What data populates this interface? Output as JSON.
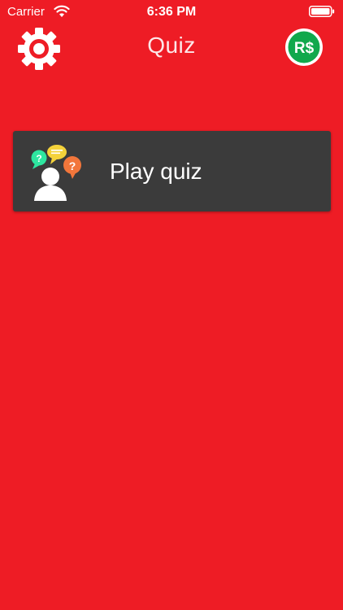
{
  "status_bar": {
    "carrier": "Carrier",
    "time": "6:36 PM",
    "wifi_icon": "wifi-icon",
    "battery_icon": "battery-icon"
  },
  "nav": {
    "title": "Quiz",
    "settings_icon": "gear-icon",
    "robux_icon": "robux-icon",
    "robux_label": "R$"
  },
  "menu": {
    "items": [
      {
        "label": "Play quiz",
        "icon": "quiz-people-icon"
      }
    ]
  },
  "colors": {
    "background": "#ee1c25",
    "card": "#3b3b3b",
    "robux_green": "#11a84c"
  }
}
